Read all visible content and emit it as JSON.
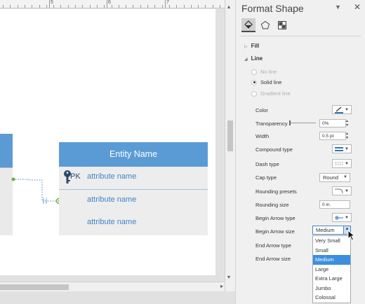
{
  "ruler": {
    "numbers": [
      "5",
      "6",
      "7"
    ]
  },
  "entity": {
    "title": "Entity Name",
    "pk_label": "PK",
    "attributes": [
      "attribute name",
      "attribute name",
      "attribute name"
    ]
  },
  "pane": {
    "title": "Format Shape",
    "pin_icon": "dropdown-caret",
    "close_icon": "close-x",
    "tabs": [
      {
        "name": "fill-line",
        "icon": "paint-bucket-icon",
        "active": true
      },
      {
        "name": "effects",
        "icon": "pentagon-icon",
        "active": false
      },
      {
        "name": "size-properties",
        "icon": "grid-icon",
        "active": false
      }
    ],
    "sections": {
      "fill": "Fill",
      "line": "Line"
    },
    "line_options": {
      "no_line": "No line",
      "solid_line": "Solid line",
      "gradient_line": "Gradient line",
      "selected": "Solid line"
    },
    "properties": {
      "color": "Color",
      "transparency": "Transparency",
      "transparency_value": "0%",
      "width": "Width",
      "width_value": "0.5 pt",
      "compound_type": "Compound type",
      "dash_type": "Dash type",
      "cap_type": "Cap type",
      "cap_type_value": "Round",
      "rounding_presets": "Rounding presets",
      "rounding_size": "Rounding size",
      "rounding_size_value": "0 in.",
      "begin_arrow_type": "Begin Arrow type",
      "begin_arrow_size": "Begin Arrow size",
      "begin_arrow_size_value": "Medium",
      "end_arrow_type": "End Arrow type",
      "end_arrow_size": "End Arrow size"
    },
    "arrow_size_options": [
      "Very Small",
      "Small",
      "Medium",
      "Large",
      "Extra Large",
      "Jumbo",
      "Colossal"
    ],
    "arrow_size_selected_index": 2
  },
  "colors": {
    "entity_header": "#5b9bd5",
    "attribute_text": "#3f85c6",
    "selection_highlight": "#3c8fdd"
  }
}
